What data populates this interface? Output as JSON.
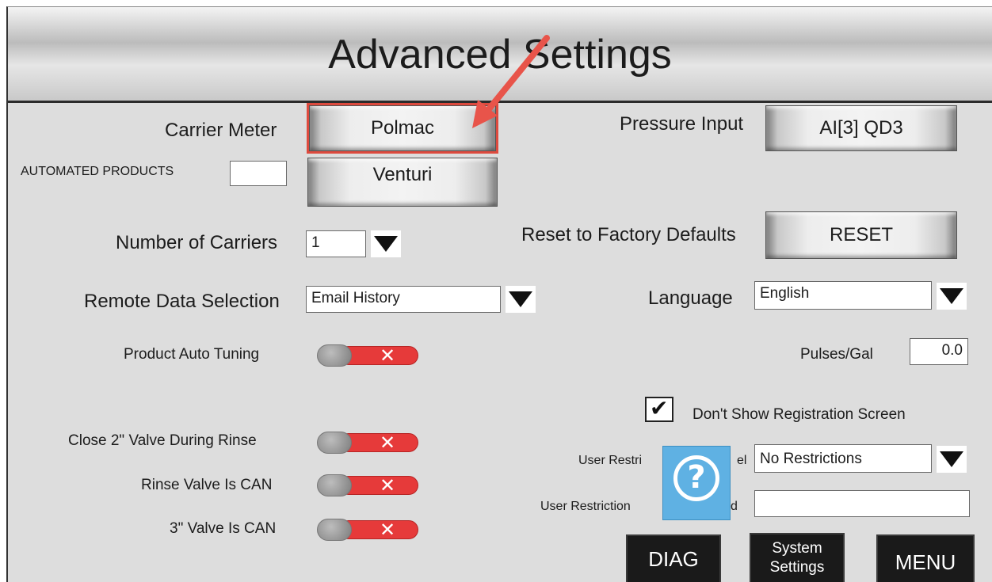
{
  "title": "Advanced Settings",
  "left": {
    "carrier_meter": {
      "label": "Carrier Meter",
      "value": "Polmac"
    },
    "automated_products": {
      "label": "AUTOMATED PRODUCTS",
      "input_value": "",
      "button": "Venturi"
    },
    "number_of_carriers": {
      "label": "Number of Carriers",
      "value": "1"
    },
    "remote_data_selection": {
      "label": "Remote Data Selection",
      "value": "Email History"
    },
    "product_auto_tuning": {
      "label": "Product Auto Tuning",
      "state": "off",
      "glyph": "✕"
    },
    "close_2_valve": {
      "label": "Close 2\" Valve During Rinse",
      "state": "off",
      "glyph": "✕"
    },
    "rinse_valve_can": {
      "label": "Rinse Valve Is CAN",
      "state": "off",
      "glyph": "✕"
    },
    "valve_3_can": {
      "label": "3\" Valve Is CAN",
      "state": "off",
      "glyph": "✕"
    }
  },
  "right": {
    "pressure_input": {
      "label": "Pressure Input",
      "value": "AI[3]  QD3"
    },
    "reset_defaults": {
      "label": "Reset to Factory Defaults",
      "button": "RESET"
    },
    "language": {
      "label": "Language",
      "value": "English"
    },
    "pulses_gal": {
      "label": "Pulses/Gal",
      "value": "0.0"
    },
    "registration": {
      "label": "Don't Show Registration Screen",
      "checked": true,
      "check_glyph": "✔"
    },
    "user_restriction_level": {
      "label_left": "User Restri",
      "label_right": "el",
      "value": "No Restrictions"
    },
    "user_restriction_password": {
      "label_left": "User Restriction",
      "label_right": "d",
      "value": ""
    }
  },
  "help": {
    "glyph": "?"
  },
  "footer": {
    "diag": "DIAG",
    "system_settings_line1": "System",
    "system_settings_line2": "Settings",
    "menu": "MENU"
  },
  "colors": {
    "background": "#dddddd",
    "toggle_off": "#e63a3a",
    "highlight": "#dd4a3e",
    "help": "#5fb1e3",
    "dark_button": "#1a1a1a"
  }
}
